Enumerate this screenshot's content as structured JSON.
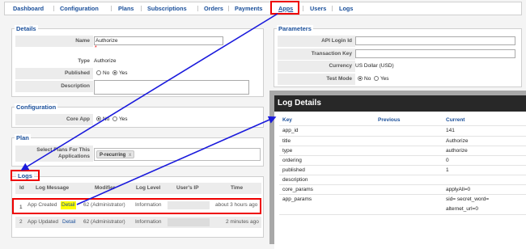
{
  "nav": [
    {
      "label": "Dashboard",
      "active": false
    },
    {
      "label": "Configuration",
      "active": false
    },
    {
      "label": "Plans",
      "active": false
    },
    {
      "label": "Subscriptions",
      "active": false
    },
    {
      "label": "Orders",
      "active": false
    },
    {
      "label": "Payments",
      "active": false
    },
    {
      "label": "Apps",
      "active": true
    },
    {
      "label": "Users",
      "active": false
    },
    {
      "label": "Logs",
      "active": false
    }
  ],
  "details": {
    "legend": "Details",
    "name_label": "Name",
    "name_value": "Authorize",
    "required_mark": "*",
    "type_label": "Type",
    "type_value": "Authorize",
    "published_label": "Published",
    "published_options": [
      "No",
      "Yes"
    ],
    "published_selected": "Yes",
    "description_label": "Description",
    "description_value": ""
  },
  "configuration": {
    "legend": "Configuration",
    "core_app_label": "Core App",
    "core_app_options": [
      "No",
      "Yes"
    ],
    "core_app_selected": "No"
  },
  "plan": {
    "legend": "Plan",
    "select_label_line1": "Select Plans For This",
    "select_label_line2": "Applications",
    "chip_label": "P-recurring",
    "chip_remove": "x"
  },
  "logs": {
    "legend": "Logs",
    "columns": [
      "Id",
      "Log Message",
      "Modifier",
      "Log Level",
      "User's IP",
      "Time"
    ],
    "rows": [
      {
        "id": "1",
        "message": "App Created",
        "detail": "Detail",
        "modifier": "62 (Administrator)",
        "level": "Information",
        "ip": "",
        "time": "about 3 hours ago"
      },
      {
        "id": "2",
        "message": "App Updated",
        "detail": "Detail",
        "modifier": "62 (Administrator)",
        "level": "Information",
        "ip": "",
        "time": "2 minutes ago"
      }
    ]
  },
  "parameters": {
    "legend": "Parameters",
    "api_login_label": "API Login Id",
    "api_login_value": "",
    "txn_key_label": "Transaction Key",
    "txn_key_value": "",
    "currency_label": "Currency",
    "currency_value": "US Dollar (USD)",
    "test_mode_label": "Test Mode",
    "test_mode_options": [
      "No",
      "Yes"
    ],
    "test_mode_selected": "No"
  },
  "log_details": {
    "title": "Log Details",
    "headers": [
      "Key",
      "Previous",
      "Current"
    ],
    "rows": [
      {
        "key": "app_id",
        "previous": "",
        "current": "141"
      },
      {
        "key": "title",
        "previous": "",
        "current": "Authorize"
      },
      {
        "key": "type",
        "previous": "",
        "current": "authorize"
      },
      {
        "key": "ordering",
        "previous": "",
        "current": "0"
      },
      {
        "key": "published",
        "previous": "",
        "current": "1"
      },
      {
        "key": "description",
        "previous": "",
        "current": ""
      },
      {
        "key": "core_params",
        "previous": "",
        "current": "applyAll=0"
      },
      {
        "key": "app_params",
        "previous": "",
        "current": "sid= secret_word="
      },
      {
        "key": "",
        "previous": "",
        "current": "alternet_url=0"
      }
    ]
  },
  "colors": {
    "link": "#1a4f9a",
    "highlight_box": "#ee0000",
    "arrow": "#1a1adc",
    "detail_highlight": "#ffff00",
    "dialog_title_bg": "#282828"
  }
}
